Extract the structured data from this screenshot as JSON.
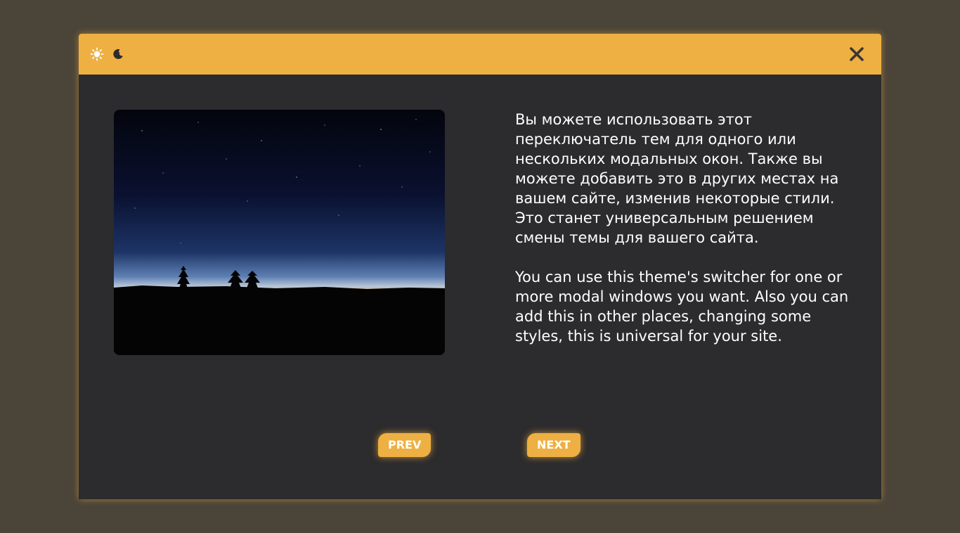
{
  "colors": {
    "background": "#4a4439",
    "accent": "#eeb043",
    "modal_body": "#2c2b2d",
    "text": "#ffffff"
  },
  "header": {
    "theme_icons": [
      "sun-icon",
      "moon-icon"
    ],
    "close_icon": "close-icon"
  },
  "content": {
    "paragraph_ru": "Вы можете использовать этот переключатель тем для одного или нескольких модальных окон. Также вы можете добавить это в других местах на вашем сайте, изменив некоторые стили. Это станет универсальным решением смены темы для вашего сайта.",
    "paragraph_en": "You can use this theme's switcher for one or more modal windows you want. Also you can add this in other places, changing some styles, this is universal for your site."
  },
  "footer": {
    "prev_label": "PREV",
    "next_label": "NEXT"
  }
}
